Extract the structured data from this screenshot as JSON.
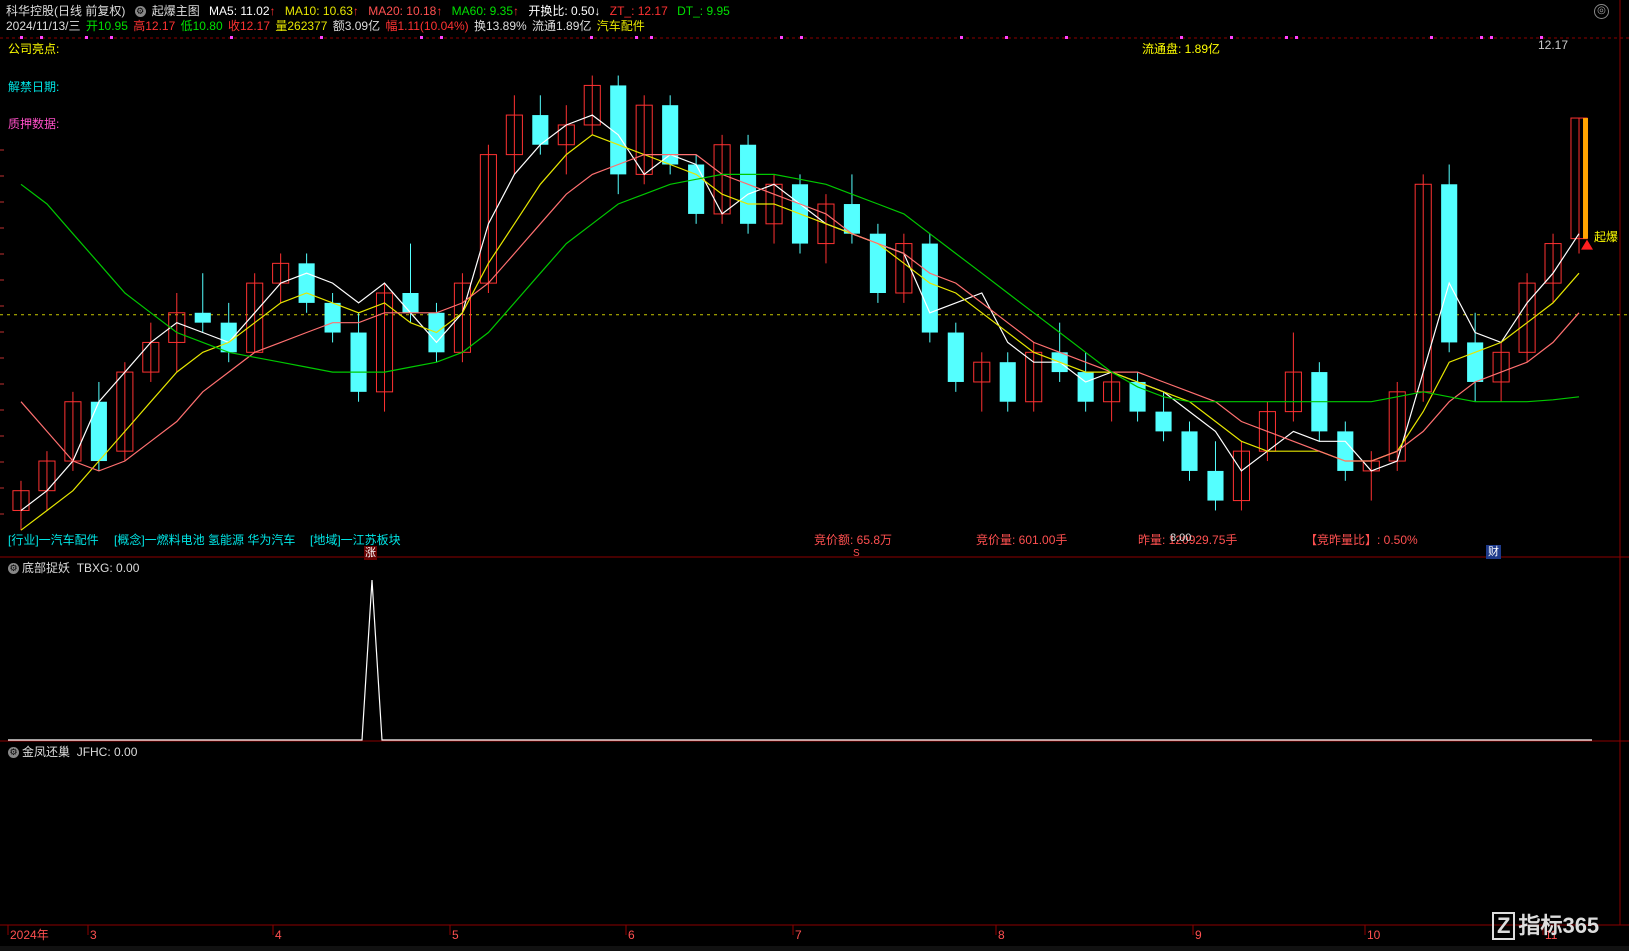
{
  "header": {
    "stock_name": "科华控股",
    "adjust": "(日线 前复权)",
    "indicator_name": "起爆主图",
    "ma5_label": "MA5: 11.02",
    "ma10_label": "MA10: 10.63",
    "ma20_label": "MA20: 10.18",
    "ma60_label": "MA60: 9.35",
    "open_ratio_label": "开换比: 0.50",
    "zt_label": "ZT_: 12.17",
    "dt_label": "DT_: 9.95",
    "arrow_up": "↑",
    "arrow_down": "↓"
  },
  "quote": {
    "date": "2024/11/13/三",
    "open": "开10.95",
    "high": "高12.17",
    "low": "低10.80",
    "close": "收12.17",
    "volume": "量262377",
    "amount": "额3.09亿",
    "change": "幅1.11(10.04%)",
    "turnover": "换13.89%",
    "float_cap": "流通1.89亿",
    "industry": "汽车配件"
  },
  "left_labels": {
    "highlight": "公司亮点:",
    "unlock": "解禁日期:",
    "pledge": "质押数据:"
  },
  "float_panel": "流通盘: 1.89亿",
  "price_tag": "12.17",
  "burst_label": "起爆",
  "bottom_info": {
    "industry": "[行业]一汽车配件",
    "concept": "[概念]一燃料电池 氢能源 华为汽车",
    "region": "[地域]一江苏板块",
    "auction_amount": "竞价额: 65.8万",
    "auction_volume": "竞价量: 601.00手",
    "prev_volume": "昨量: 120929.75手",
    "prev_volume_overlay": "8.00",
    "auction_ratio": "【竞昨量比】: 0.50%",
    "zhang_mark": "涨",
    "s_mark": "S",
    "cai_mark": "财"
  },
  "panel2": {
    "name": "底部捉妖",
    "value": "TBXG: 0.00"
  },
  "panel3": {
    "name": "金凤还巢",
    "value": "JFHC: 0.00"
  },
  "x_axis": {
    "labels": [
      "2024年",
      "3",
      "4",
      "5",
      "6",
      "7",
      "8",
      "9",
      "10",
      "11"
    ]
  },
  "logo_text": "指标365",
  "logo_mark": "Z",
  "colors": {
    "up": "#ff3232",
    "down": "#54ffff",
    "ma5": "#ffffff",
    "ma10": "#e6e600",
    "ma20": "#ff7070",
    "ma60": "#00c800",
    "grid": "#8b0000",
    "label_cyan": "#00e5e5",
    "label_pink": "#ff50c8",
    "label_yellow": "#ffff00"
  },
  "chart_data": {
    "type": "candlestick",
    "ylim": [
      7.8,
      13.0
    ],
    "reference_line": 10.18,
    "series": [
      {
        "name": "MA5",
        "values": [
          8.2,
          8.4,
          8.7,
          9.3,
          9.6,
          9.9,
          10.1,
          10.0,
          9.9,
          10.2,
          10.5,
          10.6,
          10.5,
          10.3,
          10.5,
          10.2,
          9.9,
          10.2,
          11.1,
          11.6,
          11.9,
          12.1,
          12.2,
          12.0,
          11.6,
          11.8,
          11.7,
          11.2,
          11.4,
          11.5,
          11.3,
          11.1,
          11.0,
          10.9,
          10.8,
          10.2,
          10.3,
          10.4,
          9.9,
          9.7,
          9.7,
          9.5,
          9.6,
          9.5,
          9.4,
          9.2,
          9.0,
          8.6,
          8.8,
          9.0,
          8.9,
          8.9,
          8.6,
          8.7,
          9.6,
          10.5,
          10.0,
          9.9,
          10.3,
          10.6,
          11.0
        ]
      },
      {
        "name": "MA10",
        "values": [
          8.0,
          8.2,
          8.4,
          8.7,
          9.0,
          9.3,
          9.6,
          9.8,
          9.9,
          10.1,
          10.3,
          10.4,
          10.3,
          10.2,
          10.3,
          10.1,
          10.0,
          10.2,
          10.7,
          11.1,
          11.5,
          11.8,
          12.0,
          11.9,
          11.8,
          11.7,
          11.6,
          11.4,
          11.3,
          11.3,
          11.2,
          11.1,
          11.0,
          10.9,
          10.7,
          10.5,
          10.4,
          10.2,
          10.0,
          9.8,
          9.7,
          9.6,
          9.6,
          9.5,
          9.4,
          9.3,
          9.1,
          8.9,
          8.8,
          8.8,
          8.8,
          8.7,
          8.7,
          8.8,
          9.2,
          9.7,
          9.8,
          9.9,
          10.1,
          10.3,
          10.6
        ]
      },
      {
        "name": "MA20",
        "values": [
          9.3,
          9.0,
          8.7,
          8.6,
          8.7,
          8.9,
          9.1,
          9.4,
          9.6,
          9.8,
          9.9,
          10.0,
          10.1,
          10.1,
          10.2,
          10.2,
          10.2,
          10.3,
          10.5,
          10.8,
          11.1,
          11.4,
          11.6,
          11.7,
          11.8,
          11.8,
          11.8,
          11.6,
          11.5,
          11.4,
          11.3,
          11.2,
          11.0,
          10.9,
          10.8,
          10.6,
          10.5,
          10.3,
          10.1,
          9.9,
          9.8,
          9.7,
          9.6,
          9.6,
          9.5,
          9.4,
          9.3,
          9.1,
          9.0,
          8.9,
          8.8,
          8.7,
          8.7,
          8.8,
          9.0,
          9.3,
          9.5,
          9.6,
          9.7,
          9.9,
          10.2
        ]
      },
      {
        "name": "MA60",
        "values": [
          11.5,
          11.3,
          11.0,
          10.7,
          10.4,
          10.2,
          10.0,
          9.9,
          9.8,
          9.75,
          9.7,
          9.65,
          9.6,
          9.6,
          9.6,
          9.65,
          9.7,
          9.8,
          10.0,
          10.3,
          10.6,
          10.9,
          11.1,
          11.3,
          11.4,
          11.5,
          11.55,
          11.6,
          11.6,
          11.6,
          11.55,
          11.5,
          11.4,
          11.3,
          11.2,
          11.0,
          10.8,
          10.6,
          10.4,
          10.2,
          10.0,
          9.8,
          9.6,
          9.45,
          9.35,
          9.3,
          9.3,
          9.3,
          9.3,
          9.3,
          9.3,
          9.3,
          9.3,
          9.35,
          9.4,
          9.35,
          9.3,
          9.3,
          9.3,
          9.32,
          9.35
        ]
      }
    ],
    "candles": [
      [
        8.2,
        8.5,
        8.0,
        8.4
      ],
      [
        8.4,
        8.8,
        8.2,
        8.7
      ],
      [
        8.7,
        9.4,
        8.6,
        9.3
      ],
      [
        9.3,
        9.5,
        8.6,
        8.7
      ],
      [
        8.8,
        9.7,
        8.7,
        9.6
      ],
      [
        9.6,
        10.1,
        9.5,
        9.9
      ],
      [
        9.9,
        10.4,
        9.6,
        10.2
      ],
      [
        10.2,
        10.6,
        10.0,
        10.1
      ],
      [
        10.1,
        10.3,
        9.7,
        9.8
      ],
      [
        9.8,
        10.6,
        9.8,
        10.5
      ],
      [
        10.5,
        10.8,
        10.3,
        10.7
      ],
      [
        10.7,
        10.8,
        10.2,
        10.3
      ],
      [
        10.3,
        10.4,
        9.9,
        10.0
      ],
      [
        10.0,
        10.2,
        9.3,
        9.4
      ],
      [
        9.4,
        10.5,
        9.2,
        10.4
      ],
      [
        10.4,
        10.9,
        10.1,
        10.2
      ],
      [
        10.2,
        10.3,
        9.7,
        9.8
      ],
      [
        9.8,
        10.6,
        9.7,
        10.5
      ],
      [
        10.5,
        11.9,
        10.4,
        11.8
      ],
      [
        11.8,
        12.4,
        11.6,
        12.2
      ],
      [
        12.2,
        12.4,
        11.8,
        11.9
      ],
      [
        11.9,
        12.3,
        11.6,
        12.1
      ],
      [
        12.1,
        12.6,
        12.0,
        12.5
      ],
      [
        12.5,
        12.6,
        11.4,
        11.6
      ],
      [
        11.6,
        12.4,
        11.5,
        12.3
      ],
      [
        12.3,
        12.4,
        11.6,
        11.7
      ],
      [
        11.7,
        11.8,
        11.1,
        11.2
      ],
      [
        11.2,
        12.0,
        11.1,
        11.9
      ],
      [
        11.9,
        12.0,
        11.0,
        11.1
      ],
      [
        11.1,
        11.6,
        10.9,
        11.5
      ],
      [
        11.5,
        11.6,
        10.8,
        10.9
      ],
      [
        10.9,
        11.4,
        10.7,
        11.3
      ],
      [
        11.3,
        11.6,
        10.9,
        11.0
      ],
      [
        11.0,
        11.1,
        10.3,
        10.4
      ],
      [
        10.4,
        11.0,
        10.3,
        10.9
      ],
      [
        10.9,
        11.0,
        9.9,
        10.0
      ],
      [
        10.0,
        10.1,
        9.4,
        9.5
      ],
      [
        9.5,
        9.8,
        9.2,
        9.7
      ],
      [
        9.7,
        9.8,
        9.2,
        9.3
      ],
      [
        9.3,
        9.9,
        9.2,
        9.8
      ],
      [
        9.8,
        10.1,
        9.5,
        9.6
      ],
      [
        9.6,
        9.8,
        9.2,
        9.3
      ],
      [
        9.3,
        9.6,
        9.1,
        9.5
      ],
      [
        9.5,
        9.6,
        9.1,
        9.2
      ],
      [
        9.2,
        9.4,
        8.9,
        9.0
      ],
      [
        9.0,
        9.1,
        8.5,
        8.6
      ],
      [
        8.6,
        8.9,
        8.2,
        8.3
      ],
      [
        8.3,
        8.9,
        8.2,
        8.8
      ],
      [
        8.8,
        9.3,
        8.7,
        9.2
      ],
      [
        9.2,
        10.0,
        9.1,
        9.6
      ],
      [
        9.6,
        9.7,
        8.9,
        9.0
      ],
      [
        9.0,
        9.1,
        8.5,
        8.6
      ],
      [
        8.6,
        8.8,
        8.3,
        8.7
      ],
      [
        8.7,
        9.5,
        8.6,
        9.4
      ],
      [
        9.4,
        11.6,
        9.3,
        11.5
      ],
      [
        11.5,
        11.7,
        9.8,
        9.9
      ],
      [
        9.9,
        10.2,
        9.3,
        9.5
      ],
      [
        9.5,
        9.9,
        9.3,
        9.8
      ],
      [
        9.8,
        10.6,
        9.7,
        10.5
      ],
      [
        10.5,
        11.0,
        10.3,
        10.9
      ],
      [
        10.95,
        12.17,
        10.8,
        12.17
      ]
    ]
  }
}
